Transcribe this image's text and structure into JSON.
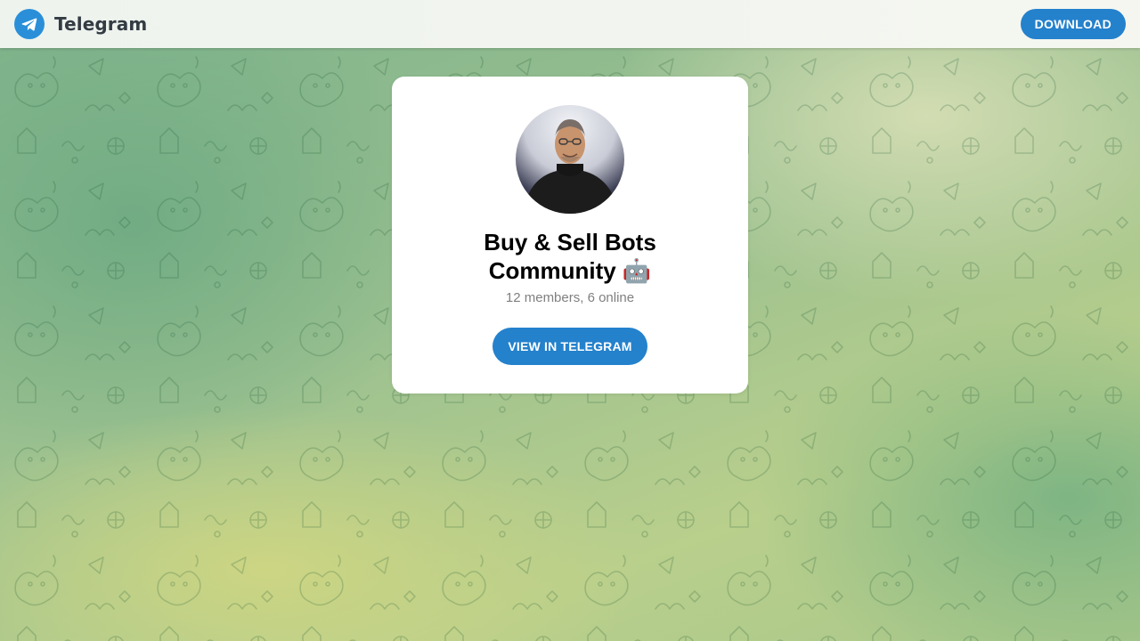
{
  "header": {
    "logo_text": "Telegram",
    "download_label": "DOWNLOAD"
  },
  "group": {
    "title": "Buy & Sell Bots Community 🤖",
    "members_info": "12 members, 6 online",
    "view_button_label": "VIEW IN TELEGRAM"
  },
  "colors": {
    "accent": "#2481cc",
    "logo_bg": "#2a8fd8",
    "subtitle": "#808080"
  },
  "icons": {
    "logo": "telegram-plane-icon"
  }
}
